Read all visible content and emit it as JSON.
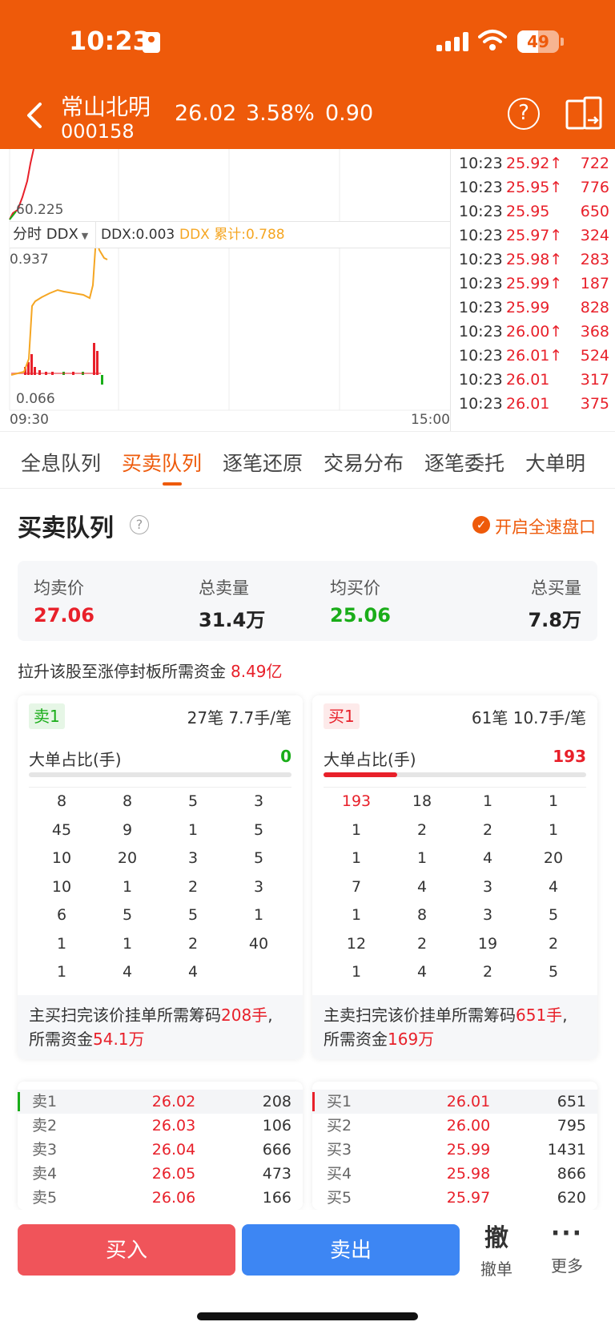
{
  "status": {
    "time": "10:23",
    "battery": "49"
  },
  "header": {
    "name": "常山北明",
    "code": "000158",
    "price": "26.02",
    "pct": "3.58%",
    "change": "0.90"
  },
  "chart": {
    "min_price_label": "60.225",
    "ddx_selector": "分时 DDX",
    "ddx_value": "DDX:0.003",
    "ddx_sum": "DDX 累计:0.788",
    "ddx_max": "0.937",
    "ddx_min": "0.066",
    "time_start": "09:30",
    "time_end": "15:00",
    "colors": {
      "line": "#F5A623",
      "up": "#E8202A",
      "down": "#1AAD19"
    }
  },
  "ticks": [
    {
      "time": "10:23",
      "price": "25.92↑",
      "vol": "722"
    },
    {
      "time": "10:23",
      "price": "25.95↑",
      "vol": "776"
    },
    {
      "time": "10:23",
      "price": "25.95",
      "vol": "650"
    },
    {
      "time": "10:23",
      "price": "25.97↑",
      "vol": "324"
    },
    {
      "time": "10:23",
      "price": "25.98↑",
      "vol": "283"
    },
    {
      "time": "10:23",
      "price": "25.99↑",
      "vol": "187"
    },
    {
      "time": "10:23",
      "price": "25.99",
      "vol": "828"
    },
    {
      "time": "10:23",
      "price": "26.00↑",
      "vol": "368"
    },
    {
      "time": "10:23",
      "price": "26.01↑",
      "vol": "524"
    },
    {
      "time": "10:23",
      "price": "26.01",
      "vol": "317"
    },
    {
      "time": "10:23",
      "price": "26.01",
      "vol": "375"
    }
  ],
  "tabs": [
    "全息队列",
    "买卖队列",
    "逐笔还原",
    "交易分布",
    "逐笔委托",
    "大单明"
  ],
  "active_tab": "买卖队列",
  "section": {
    "title": "买卖队列",
    "fast_label": "开启全速盘口"
  },
  "summary": {
    "avg_sell_label": "均卖价",
    "avg_sell": "27.06",
    "total_sell_label": "总卖量",
    "total_sell": "31.4万",
    "avg_buy_label": "均买价",
    "avg_buy": "25.06",
    "total_buy_label": "总买量",
    "total_buy": "7.8万"
  },
  "required": {
    "label": "拉升该股至涨停封板所需资金",
    "value": "8.49亿"
  },
  "sell_card": {
    "badge": "卖1",
    "info": "27笔   7.7手/笔",
    "ratio_label": "大单占比(手)",
    "ratio_value": "0",
    "ratio_fill": 0,
    "grid": [
      [
        "8",
        "8",
        "5",
        "3"
      ],
      [
        "45",
        "9",
        "1",
        "5"
      ],
      [
        "10",
        "20",
        "3",
        "5"
      ],
      [
        "10",
        "1",
        "2",
        "3"
      ],
      [
        "6",
        "5",
        "5",
        "1"
      ],
      [
        "1",
        "1",
        "2",
        "40"
      ],
      [
        "1",
        "4",
        "4",
        ""
      ]
    ],
    "foot_pre": "主买扫完该价挂单所需筹码",
    "foot_qty": "208手",
    "foot_mid": "所需资金",
    "foot_money": "54.1万"
  },
  "buy_card": {
    "badge": "买1",
    "info": "61笔   10.7手/笔",
    "ratio_label": "大单占比(手)",
    "ratio_value": "193",
    "ratio_fill": 0.28,
    "grid": [
      [
        "193",
        "18",
        "1",
        "1"
      ],
      [
        "1",
        "2",
        "2",
        "1"
      ],
      [
        "1",
        "1",
        "4",
        "20"
      ],
      [
        "7",
        "4",
        "3",
        "4"
      ],
      [
        "1",
        "8",
        "3",
        "5"
      ],
      [
        "12",
        "2",
        "19",
        "2"
      ],
      [
        "1",
        "4",
        "2",
        "5"
      ]
    ],
    "foot_pre": "主卖扫完该价挂单所需筹码",
    "foot_qty": "651手",
    "foot_mid": "所需资金",
    "foot_money": "169万"
  },
  "sell_book": [
    {
      "label": "卖1",
      "price": "26.02",
      "vol": "208"
    },
    {
      "label": "卖2",
      "price": "26.03",
      "vol": "106"
    },
    {
      "label": "卖3",
      "price": "26.04",
      "vol": "666"
    },
    {
      "label": "卖4",
      "price": "26.05",
      "vol": "473"
    },
    {
      "label": "卖5",
      "price": "26.06",
      "vol": "166"
    }
  ],
  "buy_book": [
    {
      "label": "买1",
      "price": "26.01",
      "vol": "651"
    },
    {
      "label": "买2",
      "price": "26.00",
      "vol": "795"
    },
    {
      "label": "买3",
      "price": "25.99",
      "vol": "1431"
    },
    {
      "label": "买4",
      "price": "25.98",
      "vol": "866"
    },
    {
      "label": "买5",
      "price": "25.97",
      "vol": "620"
    }
  ],
  "bottom": {
    "buy": "买入",
    "sell": "卖出",
    "cancel_glyph": "撤",
    "cancel_label": "撤单",
    "more_glyph": "···",
    "more_label": "更多"
  }
}
